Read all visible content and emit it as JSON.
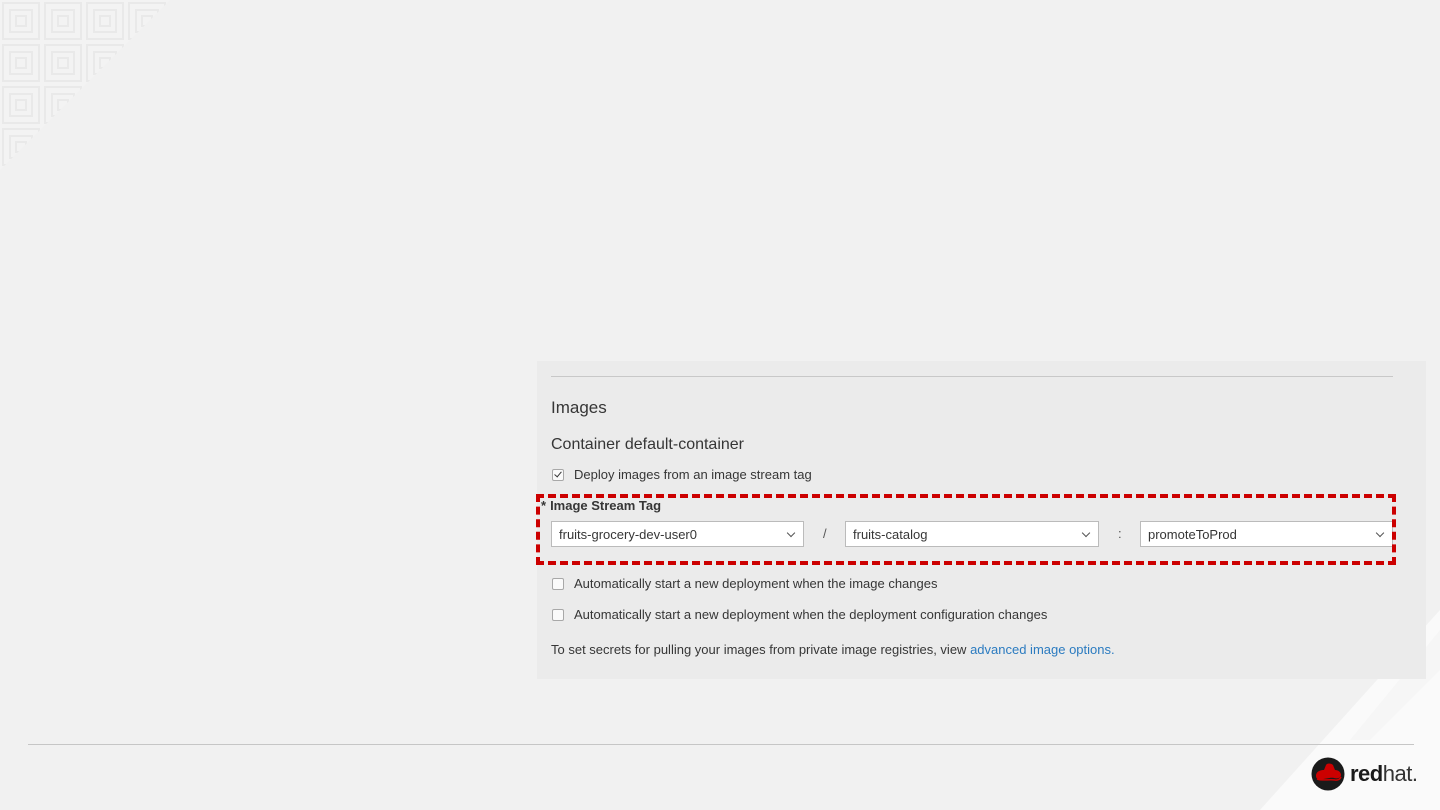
{
  "images_section": {
    "heading": "Images",
    "container_title": "Container default-container",
    "deploy_from_tag": {
      "label": "Deploy images from an image stream tag",
      "checked": true
    },
    "image_stream_tag": {
      "required_marker": "*",
      "label": "Image Stream Tag",
      "namespace": "fruits-grocery-dev-user0",
      "separator_slash": "/",
      "image_stream": "fruits-catalog",
      "separator_colon": ":",
      "tag": "promoteToProd"
    },
    "auto_image_change": {
      "label": "Automatically start a new deployment when the image changes",
      "checked": false
    },
    "auto_config_change": {
      "label": "Automatically start a new deployment when the deployment configuration changes",
      "checked": false
    },
    "secrets_text": "To set secrets for pulling your images from private image registries, view",
    "secrets_link": "advanced image options."
  },
  "branding": {
    "logo_bold": "red",
    "logo_light": "hat.",
    "logo_color": "#cc0000"
  },
  "colors": {
    "highlight": "#cc0000",
    "link": "#2b7bc0"
  }
}
